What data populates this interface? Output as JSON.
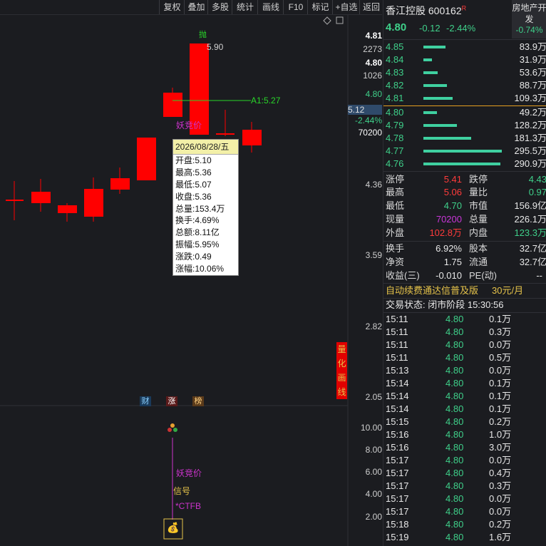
{
  "toolbar": {
    "items": [
      "复权",
      "叠加",
      "多股",
      "统计",
      "画线",
      "F10",
      "标记",
      "+自选",
      "返回"
    ]
  },
  "chart": {
    "axis_labels": [
      "4.81",
      "2273",
      "4.80",
      "1026",
      "4.80",
      "-2.44%",
      "70200",
      "4.36",
      "3.59",
      "2.82",
      "2.05"
    ],
    "crosshair_price": "5.12",
    "high_label": "5.90",
    "high_marker": "抛",
    "line_label": "A1:5.27",
    "indicator_label": "妖竞价",
    "quant_label": [
      "量",
      "化",
      "画",
      "线"
    ],
    "flags": [
      "财",
      "涨",
      "榜"
    ],
    "sub_axis": [
      "10.00",
      "8.00",
      "6.00",
      "4.00",
      "2.00"
    ],
    "sub_labels": {
      "a": "妖竞价",
      "b": "信号",
      "c": "*CTFB"
    },
    "tooltip": {
      "date": "2026/08/28/五",
      "rows": [
        "开盘:5.10",
        "最高:5.36",
        "最低:5.07",
        "收盘:5.36",
        "总量:153.4万",
        "换手:4.69%",
        "总额:8.11亿",
        "振幅:5.95%",
        "涨跌:0.49",
        "涨幅:10.06%"
      ]
    }
  },
  "stock": {
    "name": "香江控股",
    "code": "600162",
    "tag": "R",
    "price": "4.80",
    "change": "-0.12",
    "change_pct": "-2.44%",
    "sector": "房地产开发",
    "sector_pct": "-0.74%"
  },
  "orderbook": {
    "asks": [
      {
        "price": "4.85",
        "vol": "83.9万",
        "bar": 0.28
      },
      {
        "price": "4.84",
        "vol": "31.9万",
        "bar": 0.11
      },
      {
        "price": "4.83",
        "vol": "53.6万",
        "bar": 0.18
      },
      {
        "price": "4.82",
        "vol": "88.7万",
        "bar": 0.3
      },
      {
        "price": "4.81",
        "vol": "109.3万",
        "bar": 0.37
      }
    ],
    "bids": [
      {
        "price": "4.80",
        "vol": "49.2万",
        "bar": 0.17
      },
      {
        "price": "4.79",
        "vol": "128.2万",
        "bar": 0.43
      },
      {
        "price": "4.78",
        "vol": "181.3万",
        "bar": 0.61
      },
      {
        "price": "4.77",
        "vol": "295.5万",
        "bar": 1.0
      },
      {
        "price": "4.76",
        "vol": "290.9万",
        "bar": 0.98
      }
    ]
  },
  "stats": {
    "r1": {
      "l1": "涨停",
      "v1": "5.41",
      "l2": "跌停",
      "v2": "4.43"
    },
    "r2": {
      "l1": "最高",
      "v1": "5.06",
      "l2": "量比",
      "v2": "0.97"
    },
    "r3": {
      "l1": "最低",
      "v1": "4.70",
      "l2": "市值",
      "v2": "156.9亿"
    },
    "r4": {
      "l1": "现量",
      "v1": "70200",
      "l2": "总量",
      "v2": "226.1万"
    },
    "r5": {
      "l1": "外盘",
      "v1": "102.8万",
      "l2": "内盘",
      "v2": "123.3万"
    },
    "r6": {
      "l1": "换手",
      "v1": "6.92%",
      "l2": "股本",
      "v2": "32.7亿"
    },
    "r7": {
      "l1": "净资",
      "v1": "1.75",
      "l2": "流通",
      "v2": "32.7亿"
    },
    "r8": {
      "l1": "收益(三)",
      "v1": "-0.010",
      "l2": "PE(动)",
      "v2": "--"
    }
  },
  "promo": {
    "text": "自动续费通达信普及版",
    "price": "30元/月"
  },
  "trade_status": "交易状态: 闭市阶段 15:30:56",
  "ticks": [
    {
      "t": "15:11",
      "p": "4.80",
      "v": "0.1万"
    },
    {
      "t": "15:11",
      "p": "4.80",
      "v": "0.3万"
    },
    {
      "t": "15:11",
      "p": "4.80",
      "v": "0.0万"
    },
    {
      "t": "15:11",
      "p": "4.80",
      "v": "0.5万"
    },
    {
      "t": "15:13",
      "p": "4.80",
      "v": "0.0万"
    },
    {
      "t": "15:14",
      "p": "4.80",
      "v": "0.1万"
    },
    {
      "t": "15:14",
      "p": "4.80",
      "v": "0.1万"
    },
    {
      "t": "15:14",
      "p": "4.80",
      "v": "0.1万"
    },
    {
      "t": "15:15",
      "p": "4.80",
      "v": "0.2万"
    },
    {
      "t": "15:16",
      "p": "4.80",
      "v": "1.0万"
    },
    {
      "t": "15:16",
      "p": "4.80",
      "v": "3.0万"
    },
    {
      "t": "15:17",
      "p": "4.80",
      "v": "0.0万"
    },
    {
      "t": "15:17",
      "p": "4.80",
      "v": "0.4万"
    },
    {
      "t": "15:17",
      "p": "4.80",
      "v": "0.3万"
    },
    {
      "t": "15:17",
      "p": "4.80",
      "v": "0.0万"
    },
    {
      "t": "15:17",
      "p": "4.80",
      "v": "0.0万"
    },
    {
      "t": "15:18",
      "p": "4.80",
      "v": "0.2万"
    },
    {
      "t": "15:19",
      "p": "4.80",
      "v": "1.6万"
    }
  ],
  "colors": {
    "up": "#ff0000",
    "down": "#3fd08a",
    "bg": "#1b1c20"
  }
}
